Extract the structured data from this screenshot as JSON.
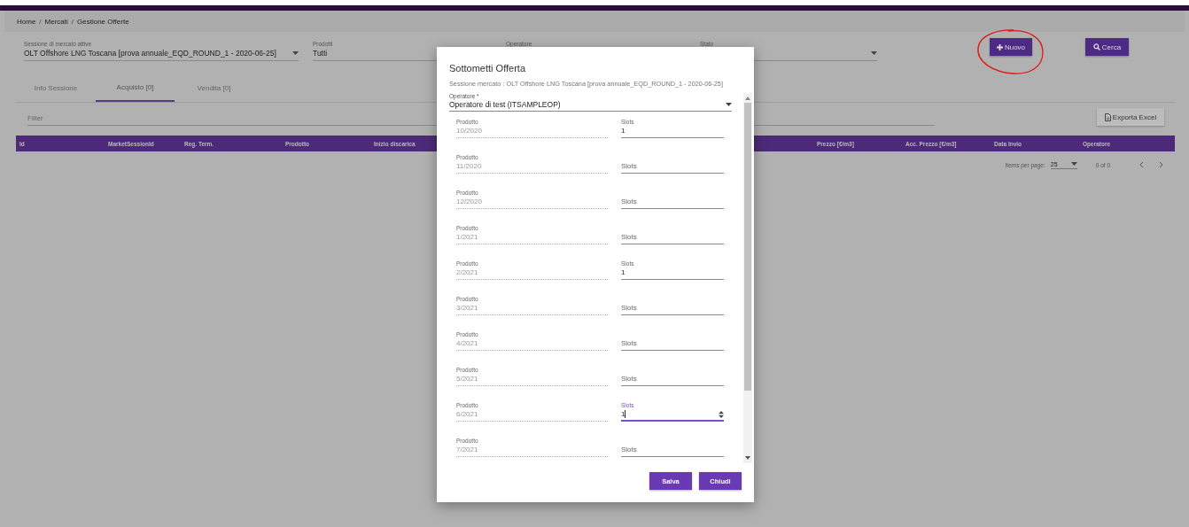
{
  "breadcrumb": {
    "separator": "/",
    "items": [
      "Home",
      "Mercati",
      "Gestione Offerte"
    ]
  },
  "filters": [
    {
      "label": "Sessione di mercato attive",
      "value": "OLT Offshore LNG Toscana [prova annuale_EQD_ROUND_1 - 2020-06-25]",
      "dropdown": true
    },
    {
      "label": "Prodotti",
      "value": "Tutti",
      "dropdown": false
    },
    {
      "label": "Operatore",
      "dropdown": false
    },
    {
      "label": "Stato",
      "dropdown": true
    }
  ],
  "actions": [
    {
      "label": "Nuovo"
    },
    {
      "label": "Cerca"
    }
  ],
  "tabs": [
    {
      "label": "Info Sessione",
      "selected": false
    },
    {
      "label": "Acquisto [0]",
      "selected": true
    },
    {
      "label": "Vendita [0]",
      "selected": false
    }
  ],
  "filter": {
    "placeholder": "Filter"
  },
  "export_button": "Exporta Excel",
  "table": {
    "columns": [
      "Id",
      "MarketSessionId",
      "Reg. Term.",
      "Prodotto",
      "Inizio discarica",
      "Prezzo [€/m3]",
      "Acc. Prezzo [€/m3]",
      "Data Invio",
      "Operatore"
    ]
  },
  "paginator": {
    "label": "Items per page:",
    "page_size": "25",
    "range": "0 of 0"
  },
  "dialog": {
    "title": "Sottometti Offerta",
    "subtitle": "Sessione mercato : OLT Offshore LNG Toscana [prova annuale_EQD_ROUND_1 - 2020-06-25]",
    "operator": {
      "label": "Operatore *",
      "value": "Operatore di test (ITSAMPLEOP)"
    },
    "rows": [
      {
        "product_label": "Prodotto",
        "product": "10/2020",
        "slots_label": "Slots",
        "value": "1",
        "focused": false
      },
      {
        "product_label": "Prodotto",
        "product": "11/2020",
        "placeholder": "Slots",
        "focused": false
      },
      {
        "product_label": "Prodotto",
        "product": "12/2020",
        "placeholder": "Slots",
        "focused": false
      },
      {
        "product_label": "Prodotto",
        "product": "1/2021",
        "placeholder": "Slots",
        "focused": false
      },
      {
        "product_label": "Prodotto",
        "product": "2/2021",
        "slots_label": "Slots",
        "value": "1",
        "focused": false
      },
      {
        "product_label": "Prodotto",
        "product": "3/2021",
        "placeholder": "Slots",
        "focused": false
      },
      {
        "product_label": "Prodotto",
        "product": "4/2021",
        "placeholder": "Slots",
        "focused": false
      },
      {
        "product_label": "Prodotto",
        "product": "5/2021",
        "placeholder": "Slots",
        "focused": false
      },
      {
        "product_label": "Prodotto",
        "product": "6/2021",
        "slots_label": "Slots",
        "value": "1",
        "focused": true
      },
      {
        "product_label": "Prodotto",
        "product": "7/2021",
        "placeholder": "Slots",
        "focused": false
      }
    ],
    "buttons": [
      "Salva",
      "Chiudi"
    ]
  }
}
